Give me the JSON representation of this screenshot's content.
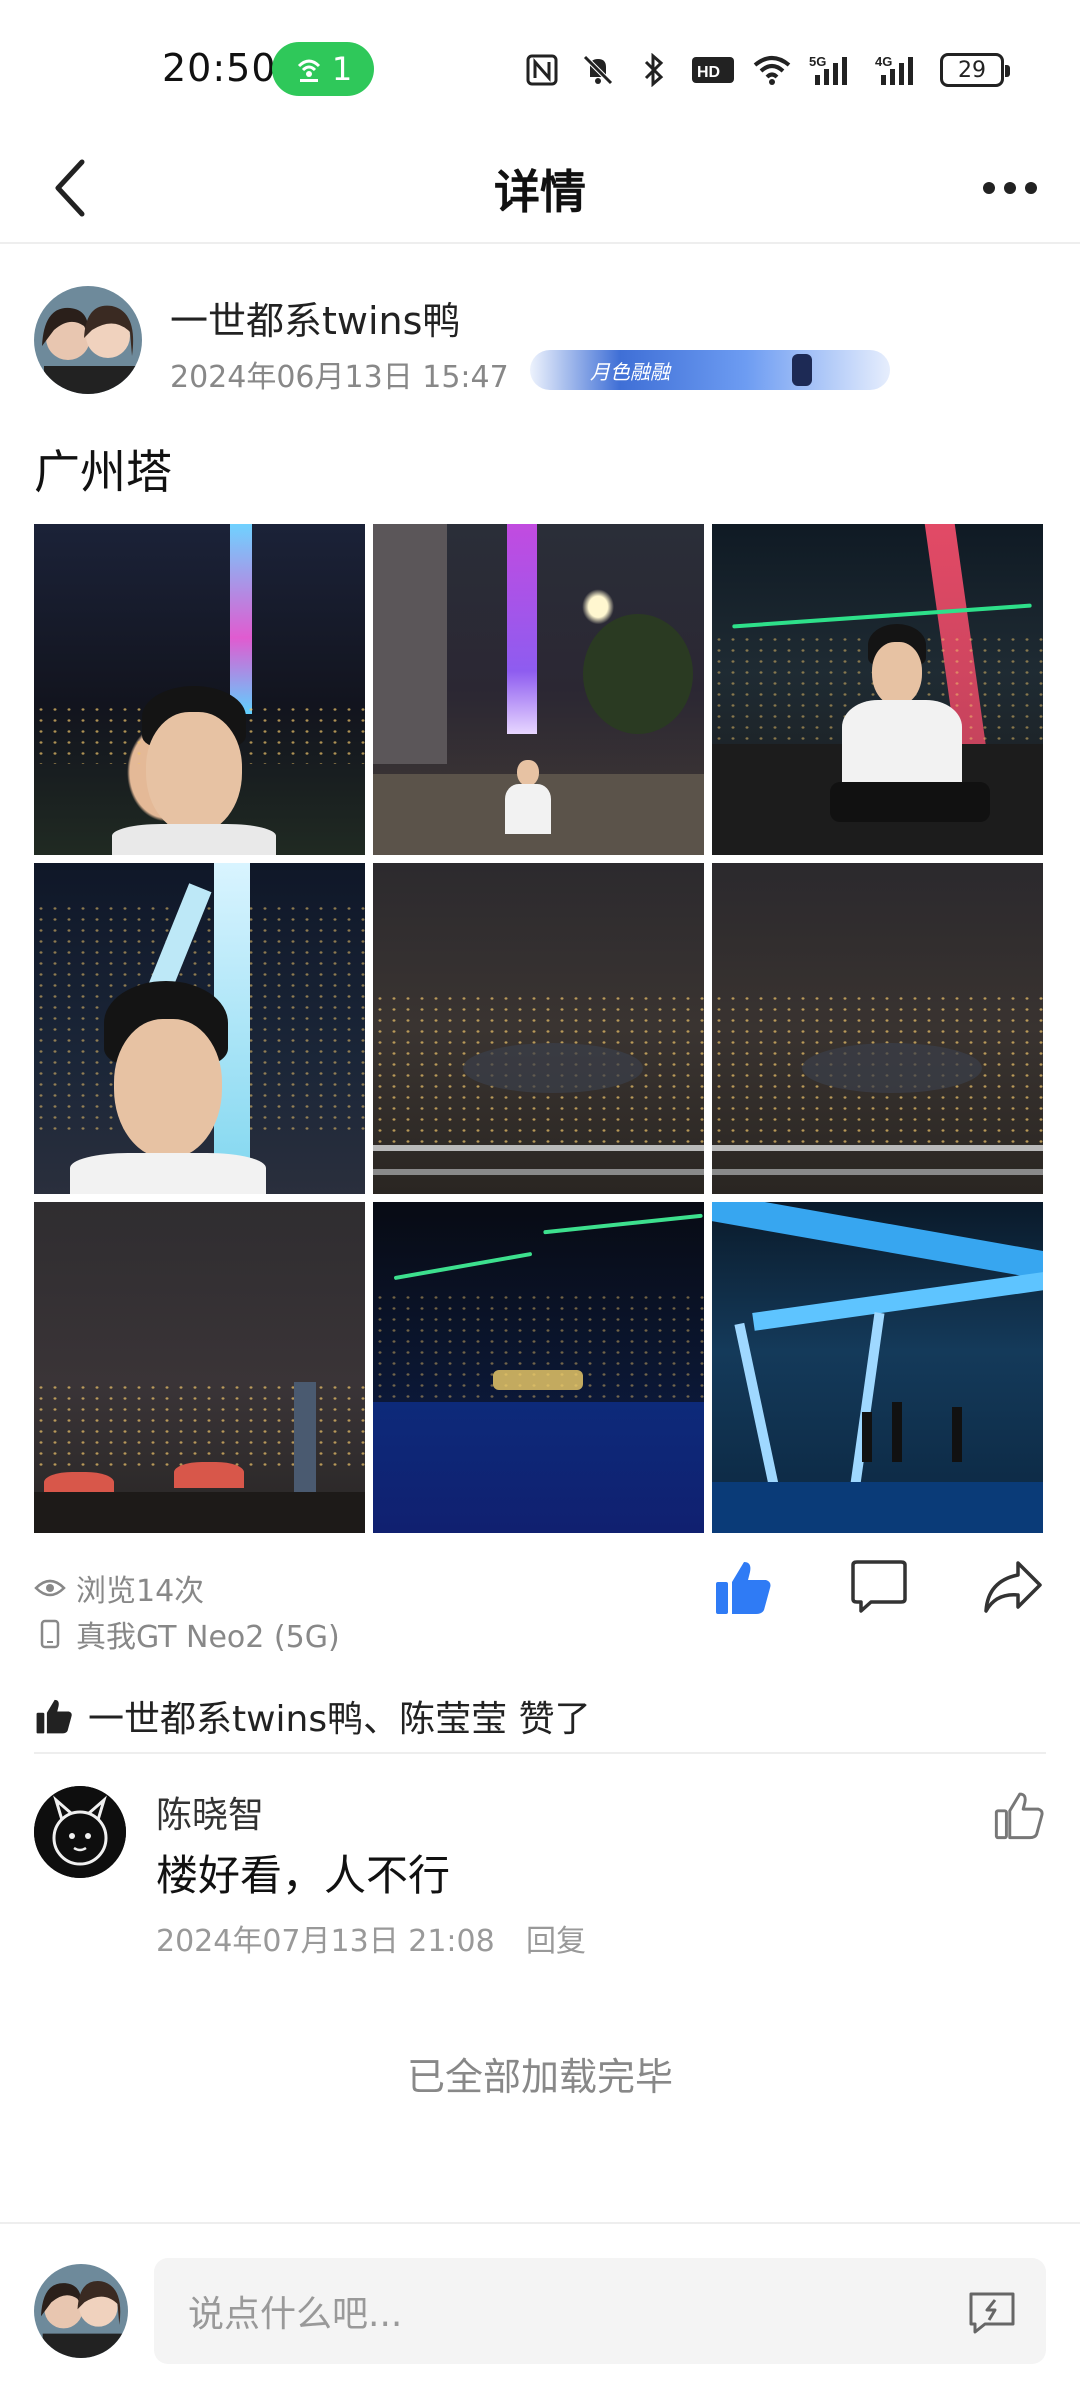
{
  "status_bar": {
    "time": "20:50",
    "hotspot_count": "1",
    "battery": "29",
    "icons": [
      "nfc-icon",
      "mute-icon",
      "bluetooth-icon",
      "hd-icon",
      "wifi-icon",
      "signal-5g-icon",
      "signal-4g-icon"
    ]
  },
  "header": {
    "title": "详情",
    "back_icon": "chevron-left-icon",
    "more_icon": "more-icon"
  },
  "post": {
    "author": "一世都系twins鸭",
    "time": "2024年06月13日 15:47",
    "badge_text": "月色融融",
    "text": "广州塔",
    "photos": [
      {
        "subject": "selfie with Canton Tower"
      },
      {
        "subject": "street view Canton Tower"
      },
      {
        "subject": "sitting in tower capsule"
      },
      {
        "subject": "selfie on observation deck"
      },
      {
        "subject": "city night view"
      },
      {
        "subject": "city night view"
      },
      {
        "subject": "observation deck crowd"
      },
      {
        "subject": "river at night"
      },
      {
        "subject": "glass observation hall"
      }
    ],
    "views": "浏览14次",
    "device": "真我GT Neo2 (5G)",
    "colors": {
      "like_blue": "#2f7bf5",
      "meta_gray": "#888888"
    }
  },
  "likes": {
    "text": "一世都系twins鸭、陈莹莹 赞了"
  },
  "comments": [
    {
      "name": "陈晓智",
      "text": "楼好看，人不行",
      "time": "2024年07月13日 21:08",
      "reply_label": "回复"
    }
  ],
  "footer": {
    "end_text": "已全部加载完毕",
    "input_placeholder": "说点什么吧..."
  }
}
